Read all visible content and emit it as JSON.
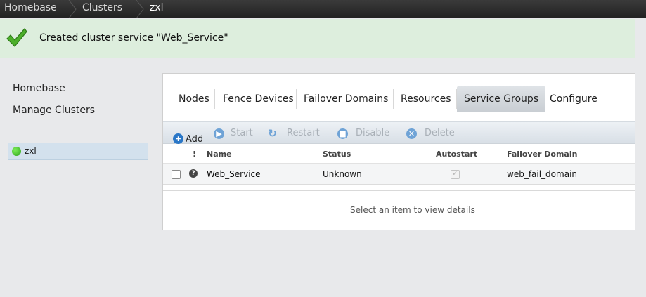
{
  "breadcrumb": {
    "items": [
      "Homebase",
      "Clusters",
      "zxl"
    ]
  },
  "notification": {
    "message": "Created cluster service \"Web_Service\""
  },
  "nav": {
    "links": [
      "Homebase",
      "Manage Clusters"
    ],
    "clusters": [
      {
        "name": "zxl",
        "status_color": "#3cba22"
      }
    ]
  },
  "tabs": [
    {
      "label": "Nodes",
      "active": false
    },
    {
      "label": "Fence Devices",
      "active": false
    },
    {
      "label": "Failover Domains",
      "active": false
    },
    {
      "label": "Resources",
      "active": false
    },
    {
      "label": "Service Groups",
      "active": true
    },
    {
      "label": "Configure",
      "active": false
    }
  ],
  "toolbar": {
    "add": "Add",
    "start": "Start",
    "restart": "Restart",
    "disable": "Disable",
    "delete": "Delete"
  },
  "table": {
    "columns": [
      "!",
      "Name",
      "Status",
      "Autostart",
      "Failover Domain"
    ],
    "rows": [
      {
        "flag_icon": "question-icon",
        "name": "Web_Service",
        "status": "Unknown",
        "autostart": true,
        "failover_domain": "web_fail_domain"
      }
    ]
  },
  "details": {
    "hint": "Select an item to view details"
  },
  "colors": {
    "accent": "#2a77c7",
    "notice_bg": "#ddeedd",
    "selected_bg": "#d3e1ed"
  }
}
